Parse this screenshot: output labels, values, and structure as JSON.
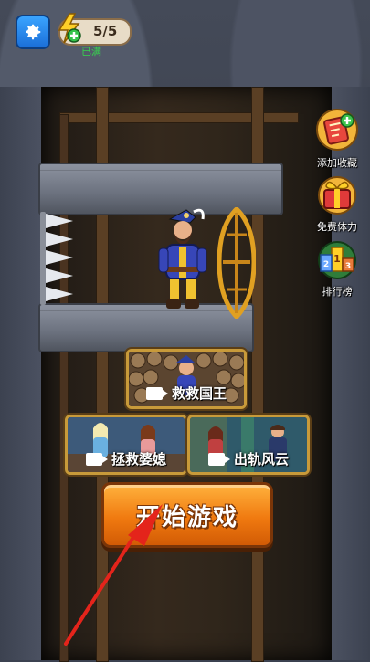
{
  "settings": {
    "icon": "gear-icon"
  },
  "energy": {
    "value": "5/5",
    "status": "已满",
    "icon": "lightning-plus-icon"
  },
  "side_menu": [
    {
      "label": "添加收藏",
      "icon": "bookmark-plus-icon"
    },
    {
      "label": "免费体力",
      "icon": "gift-box-icon"
    },
    {
      "label": "排行榜",
      "icon": "podium-icon"
    }
  ],
  "levels": [
    {
      "label": "救救国王",
      "icon": "video-icon"
    },
    {
      "label": "拯救婆媳",
      "icon": "video-icon"
    },
    {
      "label": "出轨风云",
      "icon": "video-icon"
    }
  ],
  "start_button": {
    "label": "开始游戏"
  },
  "colors": {
    "accent": "#f07a10",
    "card_border": "#c89a3a",
    "status_green": "#37d34d"
  }
}
